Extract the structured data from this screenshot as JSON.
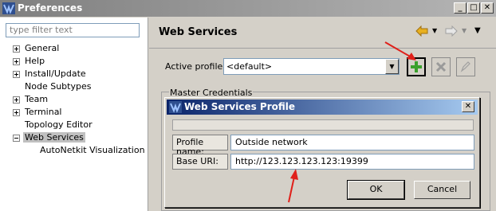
{
  "window": {
    "title": "Preferences",
    "buttons": {
      "minimize": "_",
      "maximize": "□",
      "close": "✕"
    }
  },
  "filter": {
    "placeholder": "type filter text"
  },
  "tree": {
    "items": [
      {
        "label": "General",
        "expandable": true
      },
      {
        "label": "Help",
        "expandable": true
      },
      {
        "label": "Install/Update",
        "expandable": true
      },
      {
        "label": "Node Subtypes",
        "expandable": false
      },
      {
        "label": "Team",
        "expandable": true
      },
      {
        "label": "Terminal",
        "expandable": true
      },
      {
        "label": "Topology Editor",
        "expandable": false
      },
      {
        "label": "Web Services",
        "expandable": true,
        "expanded": true,
        "selected": true
      },
      {
        "label": "AutoNetkit Visualization",
        "expandable": false,
        "child": true
      }
    ]
  },
  "page": {
    "title": "Web Services",
    "active_profile_label": "Active profile:",
    "active_profile_value": "<default>",
    "group_title": "Master Credentials"
  },
  "dialog": {
    "title": "Web Services Profile",
    "profile_name_label": "Profile name:",
    "profile_name_value": "Outside network",
    "base_uri_label": "Base URI:",
    "base_uri_value": "http://123.123.123.123:19399",
    "ok_label": "OK",
    "cancel_label": "Cancel"
  },
  "colors": {
    "annotation_arrow": "#e0201a",
    "add_icon": "#3aa02c",
    "back_icon": "#e8b020"
  }
}
